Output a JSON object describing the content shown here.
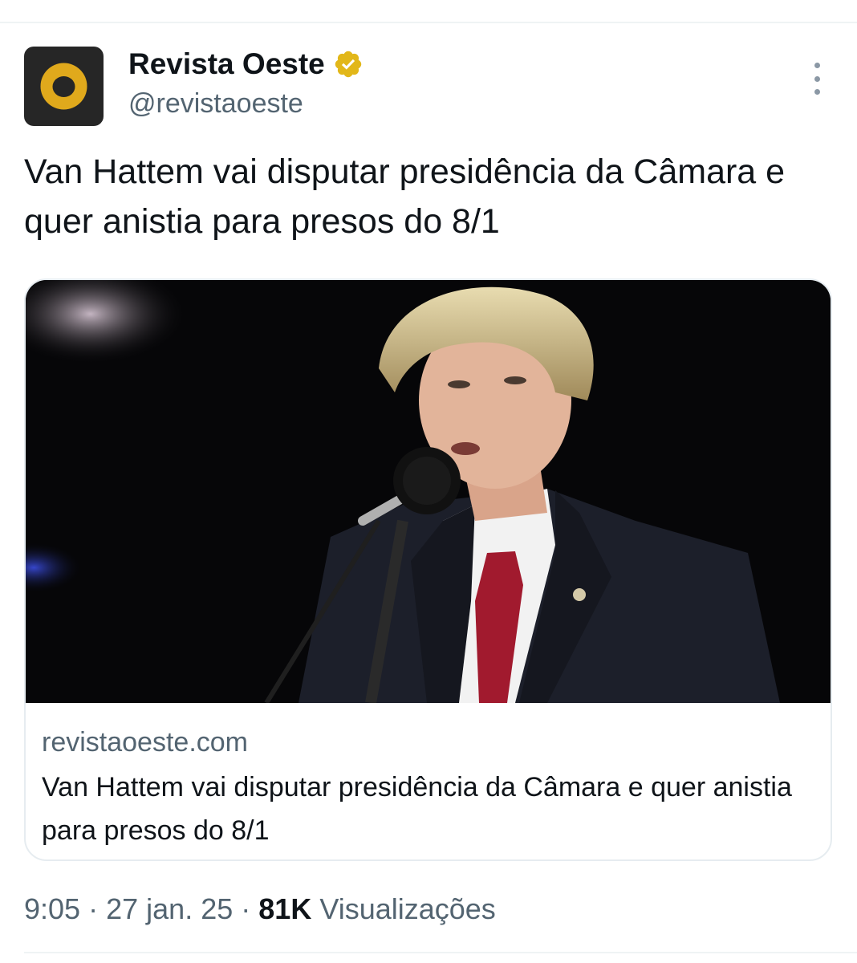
{
  "author": {
    "display_name": "Revista Oeste",
    "handle": "@revistaoeste",
    "verified_badge_color": "#e2b719",
    "avatar_colors": {
      "background": "#262626",
      "ring": "#e0a91c"
    }
  },
  "tweet": {
    "text": "Van Hattem vai disputar presidência da Câmara e quer anistia para presos do 8/1"
  },
  "link_card": {
    "domain": "revistaoeste.com",
    "title": "Van Hattem vai disputar presidência da Câmara e quer anistia para presos do 8/1",
    "image_description_icon": "photo"
  },
  "meta": {
    "time": "9:05",
    "separator": "·",
    "date": "27 jan. 25",
    "views_count": "81K",
    "views_label": "Visualizações"
  },
  "icons": {
    "more": "more-vertical-icon",
    "verified": "verified-badge-icon"
  },
  "colors": {
    "text_primary": "#0f1419",
    "text_secondary": "#536471",
    "divider": "#eff3f4"
  }
}
